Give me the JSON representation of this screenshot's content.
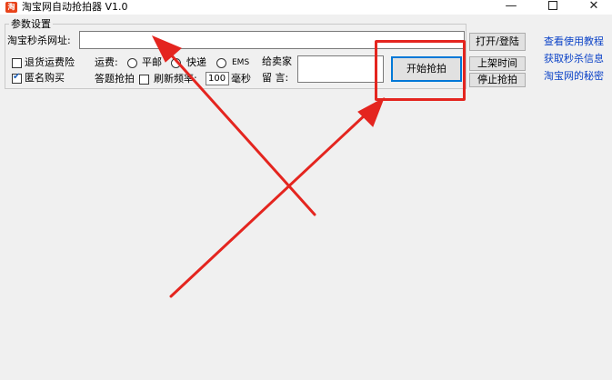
{
  "window": {
    "title": "淘宝网自动抢拍器 V1.0",
    "icon_label": "淘",
    "minimize_icon": "minimize-icon",
    "maximize_icon": "maximize-icon",
    "close_icon": "close-icon"
  },
  "params": {
    "group_title": "参数设置",
    "url_label": "淘宝秒杀网址:",
    "url_value": "",
    "return_insurance_label": "退货运费险",
    "return_insurance_checked": false,
    "anonymous_label": "匿名购买",
    "anonymous_checked": true,
    "shipping_label": "运费:",
    "shipping_options": [
      "平邮",
      "快递",
      "EMS"
    ],
    "answer_snipe_label": "答题抢拍",
    "refresh_checkbox_label": "刷新频率:",
    "refresh_checked": false,
    "refresh_value": "100",
    "refresh_unit": "毫秒",
    "seller_label": "给卖家",
    "message_label": "留 言:",
    "message_value": ""
  },
  "buttons": {
    "open_login": "打开/登陆",
    "start": "开始抢拍",
    "listing_time": "上架时间",
    "stop": "停止抢拍"
  },
  "links": {
    "tutorial": "查看使用教程",
    "get_info": "获取秒杀信息",
    "secret": "淘宝网的秘密"
  },
  "colors": {
    "annotation": "#e4251f",
    "link": "#0b42c7",
    "accent": "#0078d7"
  }
}
